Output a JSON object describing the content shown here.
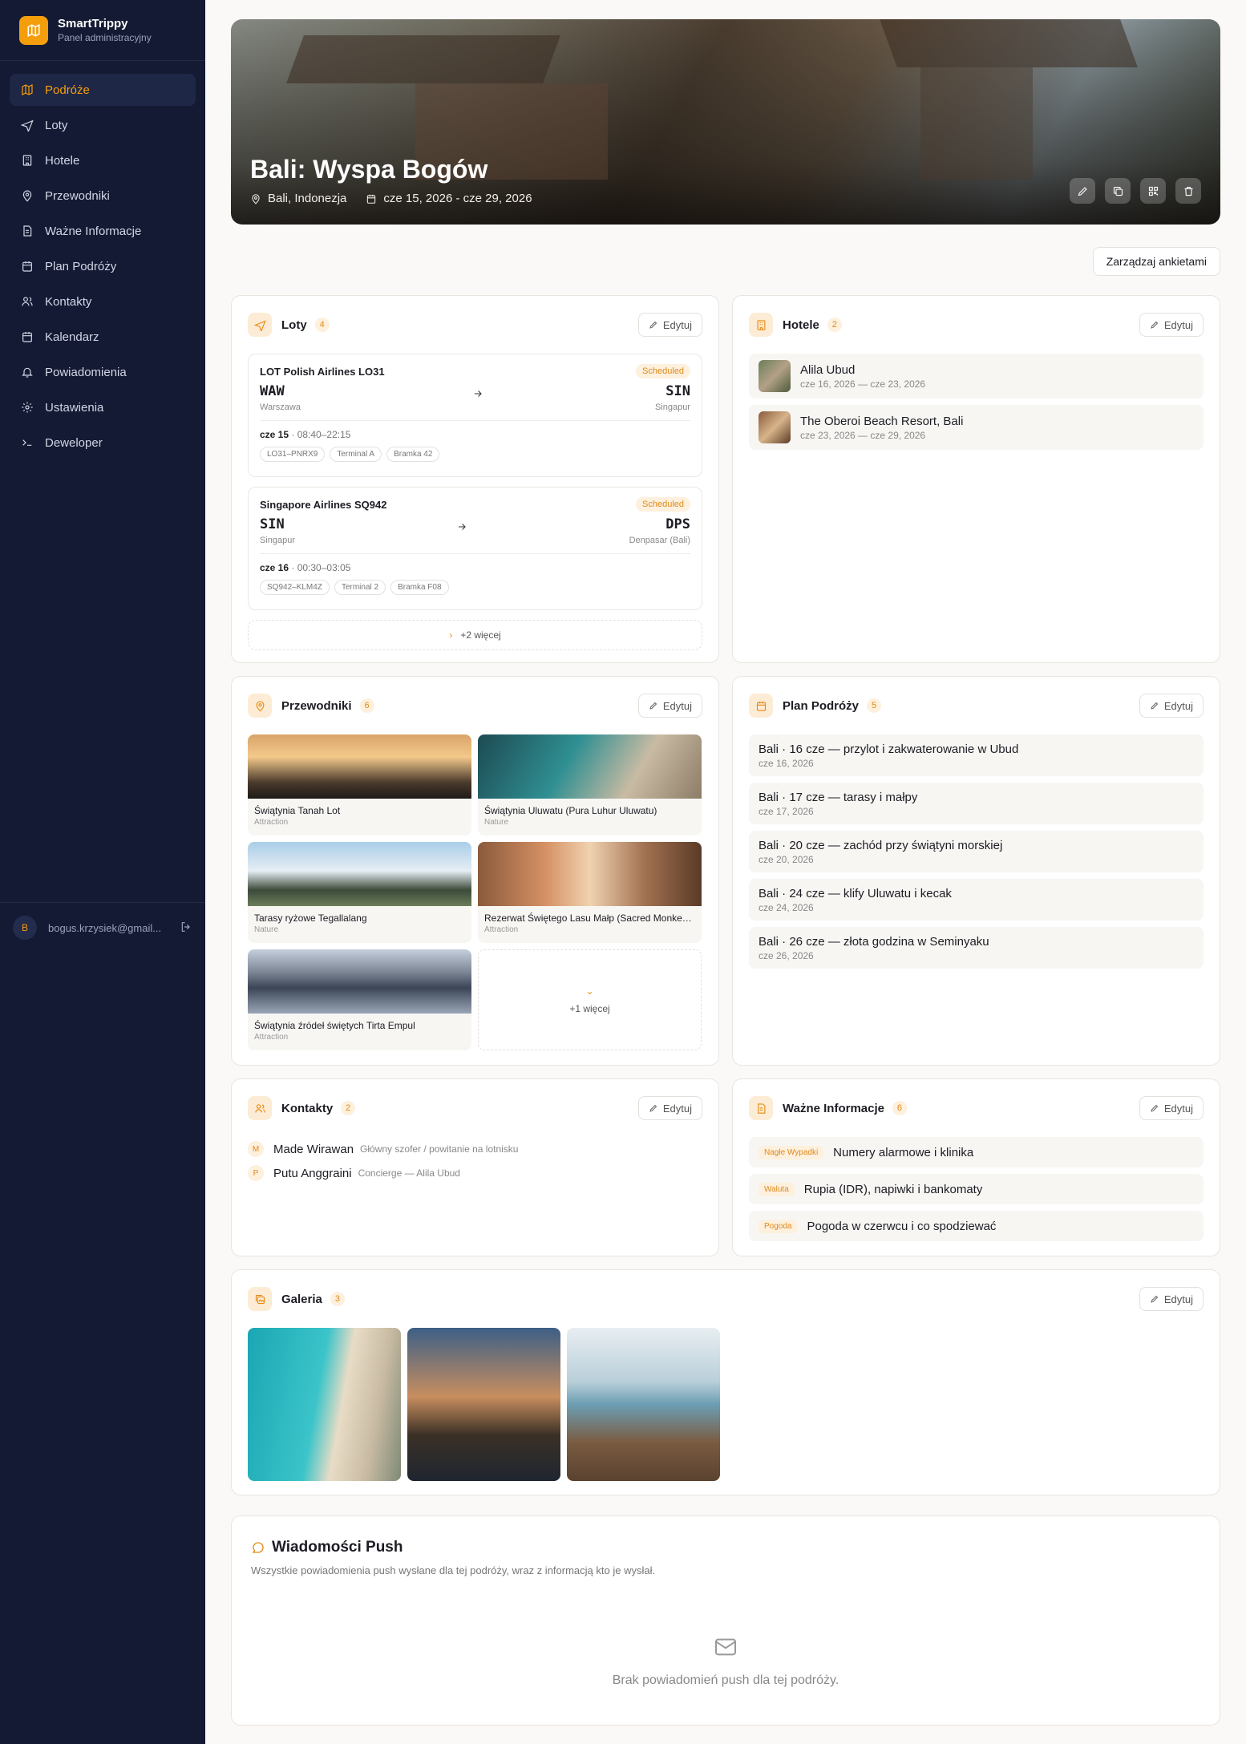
{
  "brand": {
    "name": "SmartTrippy",
    "subtitle": "Panel administracyjny"
  },
  "nav": [
    {
      "label": "Podróże",
      "icon": "map-icon",
      "active": true
    },
    {
      "label": "Loty",
      "icon": "plane-icon"
    },
    {
      "label": "Hotele",
      "icon": "building-icon"
    },
    {
      "label": "Przewodniki",
      "icon": "pin-icon"
    },
    {
      "label": "Ważne Informacje",
      "icon": "document-icon"
    },
    {
      "label": "Plan Podróży",
      "icon": "calendar-icon"
    },
    {
      "label": "Kontakty",
      "icon": "users-icon"
    },
    {
      "label": "Kalendarz",
      "icon": "calendar-icon"
    },
    {
      "label": "Powiadomienia",
      "icon": "bell-icon"
    },
    {
      "label": "Ustawienia",
      "icon": "gear-icon"
    },
    {
      "label": "Deweloper",
      "icon": "terminal-icon"
    }
  ],
  "user": {
    "initial": "B",
    "email": "bogus.krzysiek@gmail..."
  },
  "hero": {
    "title": "Bali: Wyspa Bogów",
    "location": "Bali, Indonezja",
    "dates": "cze 15, 2026 - cze 29, 2026"
  },
  "survey_button": "Zarządzaj ankietami",
  "edit_label": "Edytuj",
  "flights": {
    "title": "Loty",
    "count": "4",
    "items": [
      {
        "name": "LOT Polish Airlines LO31",
        "status": "Scheduled",
        "from_code": "WAW",
        "from_city": "Warszawa",
        "to_code": "SIN",
        "to_city": "Singapur",
        "day": "cze 15",
        "time": " · 08:40–22:15",
        "chips": [
          "LO31–PNRX9",
          "Terminal A",
          "Bramka 42"
        ]
      },
      {
        "name": "Singapore Airlines SQ942",
        "status": "Scheduled",
        "from_code": "SIN",
        "from_city": "Singapur",
        "to_code": "DPS",
        "to_city": "Denpasar (Bali)",
        "day": "cze 16",
        "time": " · 00:30–03:05",
        "chips": [
          "SQ942–KLM4Z",
          "Terminal 2",
          "Bramka F08"
        ]
      }
    ],
    "more": "+2 więcej"
  },
  "hotels": {
    "title": "Hotele",
    "count": "2",
    "items": [
      {
        "name": "Alila Ubud",
        "dates": "cze 16, 2026 — cze 23, 2026"
      },
      {
        "name": "The Oberoi Beach Resort, Bali",
        "dates": "cze 23, 2026 — cze 29, 2026"
      }
    ]
  },
  "guides": {
    "title": "Przewodniki",
    "count": "6",
    "items": [
      {
        "name": "Świątynia Tanah Lot",
        "type": "Attraction"
      },
      {
        "name": "Świątynia Uluwatu (Pura Luhur Uluwatu)",
        "type": "Nature"
      },
      {
        "name": "Tarasy ryżowe Tegallalang",
        "type": "Nature"
      },
      {
        "name": "Rezerwat Świętego Lasu Małp (Sacred Monkey Forest)",
        "type": "Attraction"
      },
      {
        "name": "Świątynia źródeł świętych Tirta Empul",
        "type": "Attraction"
      }
    ],
    "more": "+1 więcej"
  },
  "plan": {
    "title": "Plan Podróży",
    "count": "5",
    "items": [
      {
        "title": "Bali · 16 cze — przylot i zakwaterowanie w Ubud",
        "date": "cze 16, 2026"
      },
      {
        "title": "Bali · 17 cze — tarasy i małpy",
        "date": "cze 17, 2026"
      },
      {
        "title": "Bali · 20 cze — zachód przy świątyni morskiej",
        "date": "cze 20, 2026"
      },
      {
        "title": "Bali · 24 cze — klify Uluwatu i kecak",
        "date": "cze 24, 2026"
      },
      {
        "title": "Bali · 26 cze — złota godzina w Seminyaku",
        "date": "cze 26, 2026"
      }
    ]
  },
  "contacts": {
    "title": "Kontakty",
    "count": "2",
    "items": [
      {
        "initial": "M",
        "name": "Made Wirawan",
        "role": "Główny szofer / powitanie na lotnisku"
      },
      {
        "initial": "P",
        "name": "Putu Anggraini",
        "role": "Concierge — Alila Ubud"
      }
    ]
  },
  "info": {
    "title": "Ważne Informacje",
    "count": "6",
    "items": [
      {
        "tag": "Nagłe Wypadki",
        "text": "Numery alarmowe i klinika"
      },
      {
        "tag": "Waluta",
        "text": "Rupia (IDR), napiwki i bankomaty"
      },
      {
        "tag": "Pogoda",
        "text": "Pogoda w czerwcu i co spodziewać"
      }
    ]
  },
  "gallery": {
    "title": "Galeria",
    "count": "3"
  },
  "push": {
    "title": "Wiadomości Push",
    "desc": "Wszystkie powiadomienia push wysłane dla tej podróży, wraz z informacją kto je wysłał.",
    "empty": "Brak powiadomień push dla tej podróży."
  },
  "colors": {
    "accent": "#f59e0b",
    "sidebar": "#141a33"
  }
}
